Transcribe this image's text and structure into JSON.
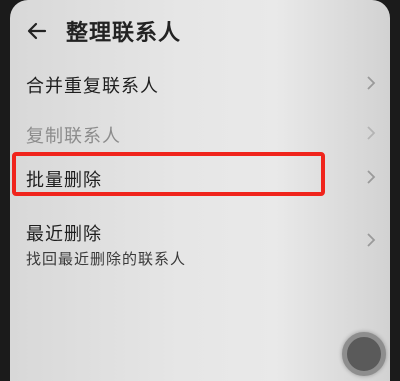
{
  "header": {
    "back_icon": "back-arrow-icon",
    "title": "整理联系人"
  },
  "items": [
    {
      "label": "合并重复联系人",
      "enabled": true
    },
    {
      "label": "复制联系人",
      "enabled": false
    },
    {
      "label": "批量删除",
      "enabled": true,
      "highlighted": true
    },
    {
      "label": "最近删除",
      "subtitle": "找回最近删除的联系人",
      "enabled": true
    }
  ],
  "colors": {
    "highlight_border": "#f0241c",
    "background": "#e6e6e6"
  },
  "floating_button": {
    "icon": "assistive-touch-icon"
  }
}
